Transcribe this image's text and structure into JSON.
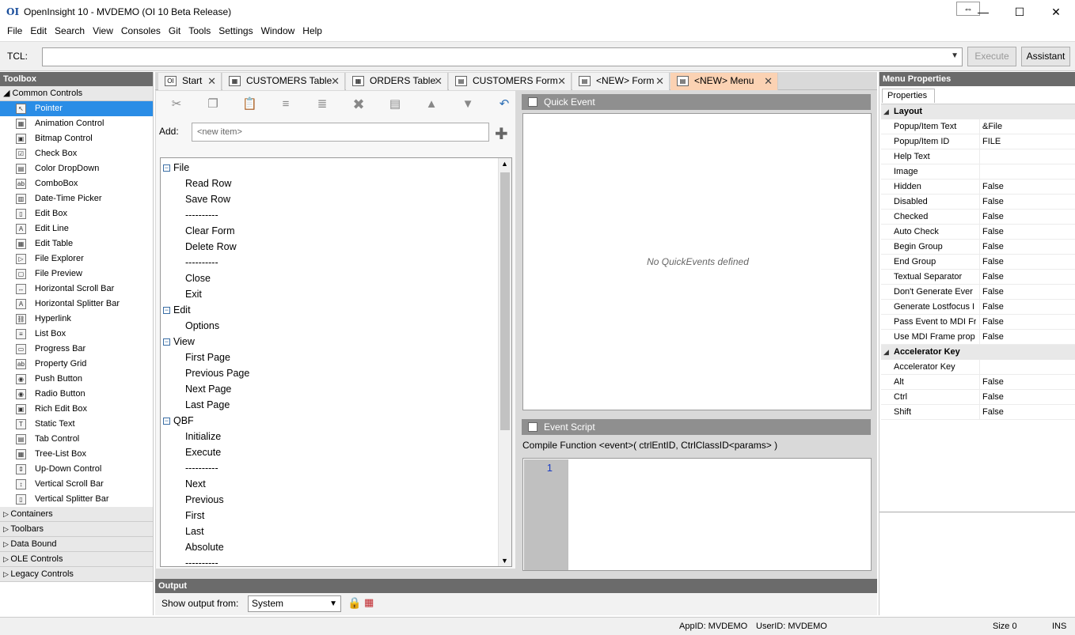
{
  "window": {
    "logo": "OI",
    "title": "OpenInsight 10 - MVDEMO (OI 10 Beta Release)",
    "restore_glyph": "⇔",
    "minimize_glyph": "—",
    "maximize_glyph": "☐",
    "close_glyph": "✕"
  },
  "menu": [
    "File",
    "Edit",
    "Search",
    "View",
    "Consoles",
    "Git",
    "Tools",
    "Settings",
    "Window",
    "Help"
  ],
  "tcl": {
    "label": "TCL:",
    "value": "",
    "execute_label": "Execute",
    "assistant_label": "Assistant"
  },
  "toolbox": {
    "title": "Toolbox",
    "group": "Common Controls",
    "items": [
      "Pointer",
      "Animation Control",
      "Bitmap Control",
      "Check Box",
      "Color DropDown",
      "ComboBox",
      "Date-Time Picker",
      "Edit Box",
      "Edit Line",
      "Edit Table",
      "File Explorer",
      "File Preview",
      "Horizontal Scroll Bar",
      "Horizontal Splitter Bar",
      "Hyperlink",
      "List Box",
      "Progress Bar",
      "Property Grid",
      "Push Button",
      "Radio Button",
      "Rich Edit Box",
      "Static Text",
      "Tab Control",
      "Tree-List Box",
      "Up-Down Control",
      "Vertical Scroll Bar",
      "Vertical Splitter Bar"
    ],
    "groups": [
      "Containers",
      "Toolbars",
      "Data Bound",
      "OLE Controls",
      "Legacy Controls"
    ]
  },
  "tabs": [
    {
      "label": "Start",
      "active": false
    },
    {
      "label": "CUSTOMERS Table",
      "active": false
    },
    {
      "label": "ORDERS Table",
      "active": false
    },
    {
      "label": "CUSTOMERS Form",
      "active": false
    },
    {
      "label": "<NEW> Form",
      "active": false
    },
    {
      "label": "<NEW> Menu",
      "active": true
    }
  ],
  "editor": {
    "add_label": "Add:",
    "add_placeholder": "<new item>",
    "tree": [
      {
        "label": "File",
        "level": 0
      },
      {
        "label": "Read Row",
        "level": 1
      },
      {
        "label": "Save Row",
        "level": 1
      },
      {
        "label": "----------",
        "level": 1
      },
      {
        "label": "Clear Form",
        "level": 1
      },
      {
        "label": "Delete Row",
        "level": 1
      },
      {
        "label": "----------",
        "level": 1
      },
      {
        "label": "Close",
        "level": 1
      },
      {
        "label": "Exit",
        "level": 1
      },
      {
        "label": "Edit",
        "level": 0
      },
      {
        "label": "Options",
        "level": 1
      },
      {
        "label": "View",
        "level": 0
      },
      {
        "label": "First Page",
        "level": 1
      },
      {
        "label": "Previous Page",
        "level": 1
      },
      {
        "label": "Next Page",
        "level": 1
      },
      {
        "label": "Last Page",
        "level": 1
      },
      {
        "label": "QBF",
        "level": 0
      },
      {
        "label": "Initialize",
        "level": 1
      },
      {
        "label": "Execute",
        "level": 1
      },
      {
        "label": "----------",
        "level": 1
      },
      {
        "label": "Next",
        "level": 1
      },
      {
        "label": "Previous",
        "level": 1
      },
      {
        "label": "First",
        "level": 1
      },
      {
        "label": "Last",
        "level": 1
      },
      {
        "label": "Absolute",
        "level": 1
      },
      {
        "label": "----------",
        "level": 1
      }
    ]
  },
  "quickevent": {
    "title": "Quick Event",
    "empty": "No QuickEvents defined"
  },
  "eventscript": {
    "title": "Event Script",
    "compile": "Compile Function <event>( ctrlEntID, CtrlClassID<params> )",
    "line_number": "1"
  },
  "output": {
    "title": "Output",
    "show_label": "Show output from:",
    "source": "System"
  },
  "props": {
    "title": "Menu Properties",
    "tab": "Properties",
    "layout_title": "Layout",
    "layout": [
      [
        "Popup/Item Text",
        "&File"
      ],
      [
        "Popup/Item ID",
        "FILE"
      ],
      [
        "Help Text",
        ""
      ],
      [
        "Image",
        ""
      ],
      [
        "Hidden",
        "False"
      ],
      [
        "Disabled",
        "False"
      ],
      [
        "Checked",
        "False"
      ],
      [
        "Auto Check",
        "False"
      ],
      [
        "Begin Group",
        "False"
      ],
      [
        "End Group",
        "False"
      ],
      [
        "Textual Separator",
        "False"
      ],
      [
        "Don't Generate Ever",
        "False"
      ],
      [
        "Generate Lostfocus I",
        "False"
      ],
      [
        "Pass Event to MDI Fr",
        "False"
      ],
      [
        "Use MDI Frame prop",
        "False"
      ]
    ],
    "accel_title": "Accelerator Key",
    "accel": [
      [
        "Accelerator Key",
        ""
      ],
      [
        "Alt",
        "False"
      ],
      [
        "Ctrl",
        "False"
      ],
      [
        "Shift",
        "False"
      ]
    ]
  },
  "status": {
    "appid": "AppID: MVDEMO",
    "userid": "UserID: MVDEMO",
    "size": "Size 0",
    "mode": "INS"
  }
}
